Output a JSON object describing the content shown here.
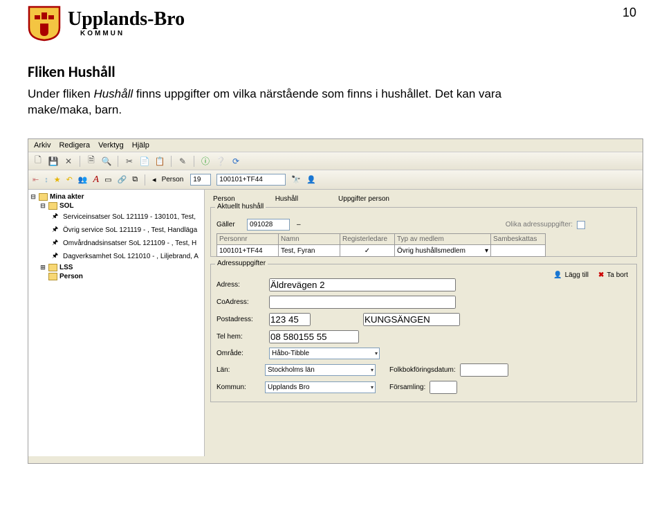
{
  "page_number": "10",
  "brand": {
    "title": "Upplands-Bro",
    "sub": "KOMMUN"
  },
  "doc": {
    "heading": "Fliken Hushåll",
    "text_plain": "Under fliken Hushåll finns uppgifter om vilka närstående som finns i hushållet. Det kan vara make/maka, barn."
  },
  "menubar": [
    "Arkiv",
    "Redigera",
    "Verktyg",
    "Hjälp"
  ],
  "person_bar": {
    "label": "Person",
    "id": "19",
    "pnr": "100101+TF44"
  },
  "tree": {
    "root": "Mina akter",
    "sol": "SOL",
    "items": [
      "Serviceinsatser SoL 121119 - 130101, Test,",
      "Övrig service SoL 121119 - , Test, Handläga",
      "Omvårdnadsinsatser SoL 121109 - , Test, H",
      "Dagverksamhet SoL 121010 - , Liljebrand, A"
    ],
    "lss": "LSS",
    "person": "Person"
  },
  "tabs": [
    "Person",
    "Hushåll",
    "Uppgifter person"
  ],
  "aktuellt": {
    "legend": "Aktuellt hushåll",
    "galler_label": "Gäller",
    "galler_value": "091028",
    "olika_label": "Olika adressuppgifter:",
    "headers": [
      "Personnr",
      "Namn",
      "Registerledare",
      "Typ av medlem",
      "Sambeskattas"
    ],
    "row": {
      "personnr": "100101+TF44",
      "namn": "Test, Fyran",
      "registerledare_checked": true,
      "typ": "Övrig hushållsmedlem"
    }
  },
  "address": {
    "legend": "Adressuppgifter",
    "labels": {
      "adress": "Adress:",
      "coadress": "CoAdress:",
      "post": "Postadress:",
      "tel": "Tel hem:",
      "omrade": "Område:",
      "lan": "Län:",
      "kommun": "Kommun:",
      "folkbok": "Folkbokföringsdatum:",
      "forsamling": "Församling:"
    },
    "values": {
      "adress": "Äldrevägen 2",
      "coadress": "",
      "post1": "123 45",
      "post2": "KUNGSÄNGEN",
      "tel": "08 580155 55",
      "omrade": "Håbo-Tibble",
      "lan": "Stockholms län",
      "kommun": "Upplands Bro",
      "folkbok": "",
      "forsamling": ""
    },
    "buttons": {
      "add": "Lägg till",
      "remove": "Ta bort"
    }
  }
}
